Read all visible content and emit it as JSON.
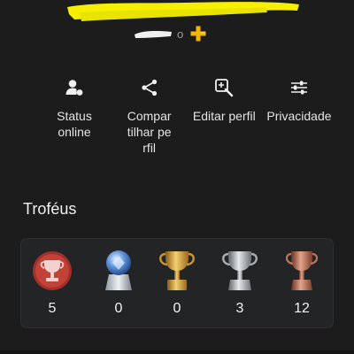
{
  "profile": {
    "name_redacted_color": "#f6f000",
    "online_id_suffix": "o",
    "plus_icon": "playstation-plus-icon",
    "plus_color": "#f4b400"
  },
  "actions": [
    {
      "label": "Status online",
      "icon": "status-online-icon"
    },
    {
      "label": "Compartilhar perfil",
      "icon": "share-icon"
    },
    {
      "label": "Editar perfil",
      "icon": "edit-profile-icon"
    },
    {
      "label": "Privacidade",
      "icon": "privacy-sliders-icon"
    }
  ],
  "trophies": {
    "title": "Troféus",
    "items": [
      {
        "kind": "level",
        "icon": "trophy-level-icon",
        "count": "5",
        "color": "#b83a32"
      },
      {
        "kind": "platinum",
        "icon": "platinum-trophy-icon",
        "count": "0",
        "color": "#9fb9dd"
      },
      {
        "kind": "gold",
        "icon": "gold-trophy-icon",
        "count": "0",
        "color": "#d8a53a"
      },
      {
        "kind": "silver",
        "icon": "silver-trophy-icon",
        "count": "3",
        "color": "#bfc3c8"
      },
      {
        "kind": "bronze",
        "icon": "bronze-trophy-icon",
        "count": "12",
        "color": "#c0785a"
      }
    ]
  }
}
